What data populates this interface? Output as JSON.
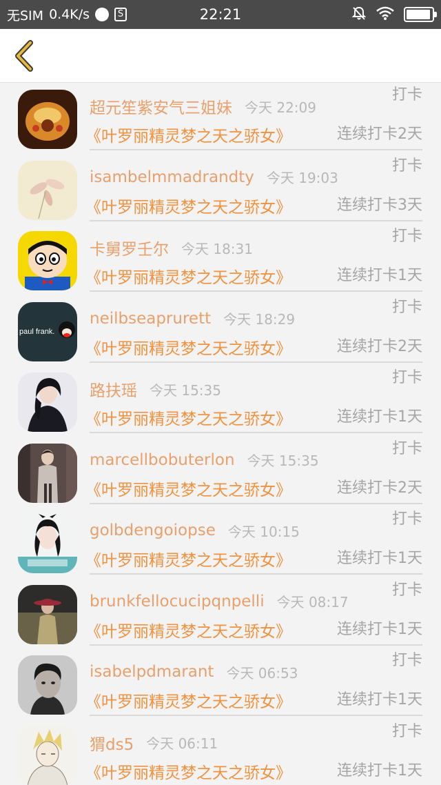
{
  "status_bar": {
    "carrier": "无SIM",
    "speed": "0.4K/s",
    "time": "22:21",
    "icons": [
      "weather-icon",
      "sim-s-icon",
      "mute-icon",
      "wifi-icon",
      "battery-icon"
    ]
  },
  "nav": {
    "back_icon": "chevron-left-icon"
  },
  "colors": {
    "name": "#e8a06c",
    "book": "#f0923f",
    "muted": "#a5a5a5",
    "time": "#b8b8b8",
    "back": "#e0b040"
  },
  "records": [
    {
      "name": "超元笙紫安气三姐妹",
      "time": "今天 22:09",
      "action": "打卡",
      "book": "《叶罗丽精灵梦之天之骄女》",
      "streak": "连续打卡2天"
    },
    {
      "name": "isambelmmadrandty",
      "time": "今天 19:03",
      "action": "打卡",
      "book": "《叶罗丽精灵梦之天之骄女》",
      "streak": "连续打卡3天"
    },
    {
      "name": "卡舅罗壬尔",
      "time": "今天 18:31",
      "action": "打卡",
      "book": "《叶罗丽精灵梦之天之骄女》",
      "streak": "连续打卡1天"
    },
    {
      "name": "neilbseaprurett",
      "time": "今天 18:29",
      "action": "打卡",
      "book": "《叶罗丽精灵梦之天之骄女》",
      "streak": "连续打卡2天",
      "avatar_text": "paul frank."
    },
    {
      "name": "路扶瑶",
      "time": "今天 15:35",
      "action": "打卡",
      "book": "《叶罗丽精灵梦之天之骄女》",
      "streak": "连续打卡1天"
    },
    {
      "name": "marcellbobuterlon",
      "time": "今天 15:35",
      "action": "打卡",
      "book": "《叶罗丽精灵梦之天之骄女》",
      "streak": "连续打卡2天"
    },
    {
      "name": "golbdengoiopse",
      "time": "今天 10:15",
      "action": "打卡",
      "book": "《叶罗丽精灵梦之天之骄女》",
      "streak": "连续打卡1天"
    },
    {
      "name": "brunkfellocucipqnpelli",
      "time": "今天 08:17",
      "action": "打卡",
      "book": "《叶罗丽精灵梦之天之骄女》",
      "streak": "连续打卡1天"
    },
    {
      "name": "isabelpdmarant",
      "time": "今天 06:53",
      "action": "打卡",
      "book": "《叶罗丽精灵梦之天之骄女》",
      "streak": "连续打卡1天"
    },
    {
      "name": "猬ds5",
      "time": "今天 06:11",
      "action": "打卡",
      "book": "《叶罗丽精灵梦之天之骄女》",
      "streak": "连续打卡1天"
    }
  ]
}
